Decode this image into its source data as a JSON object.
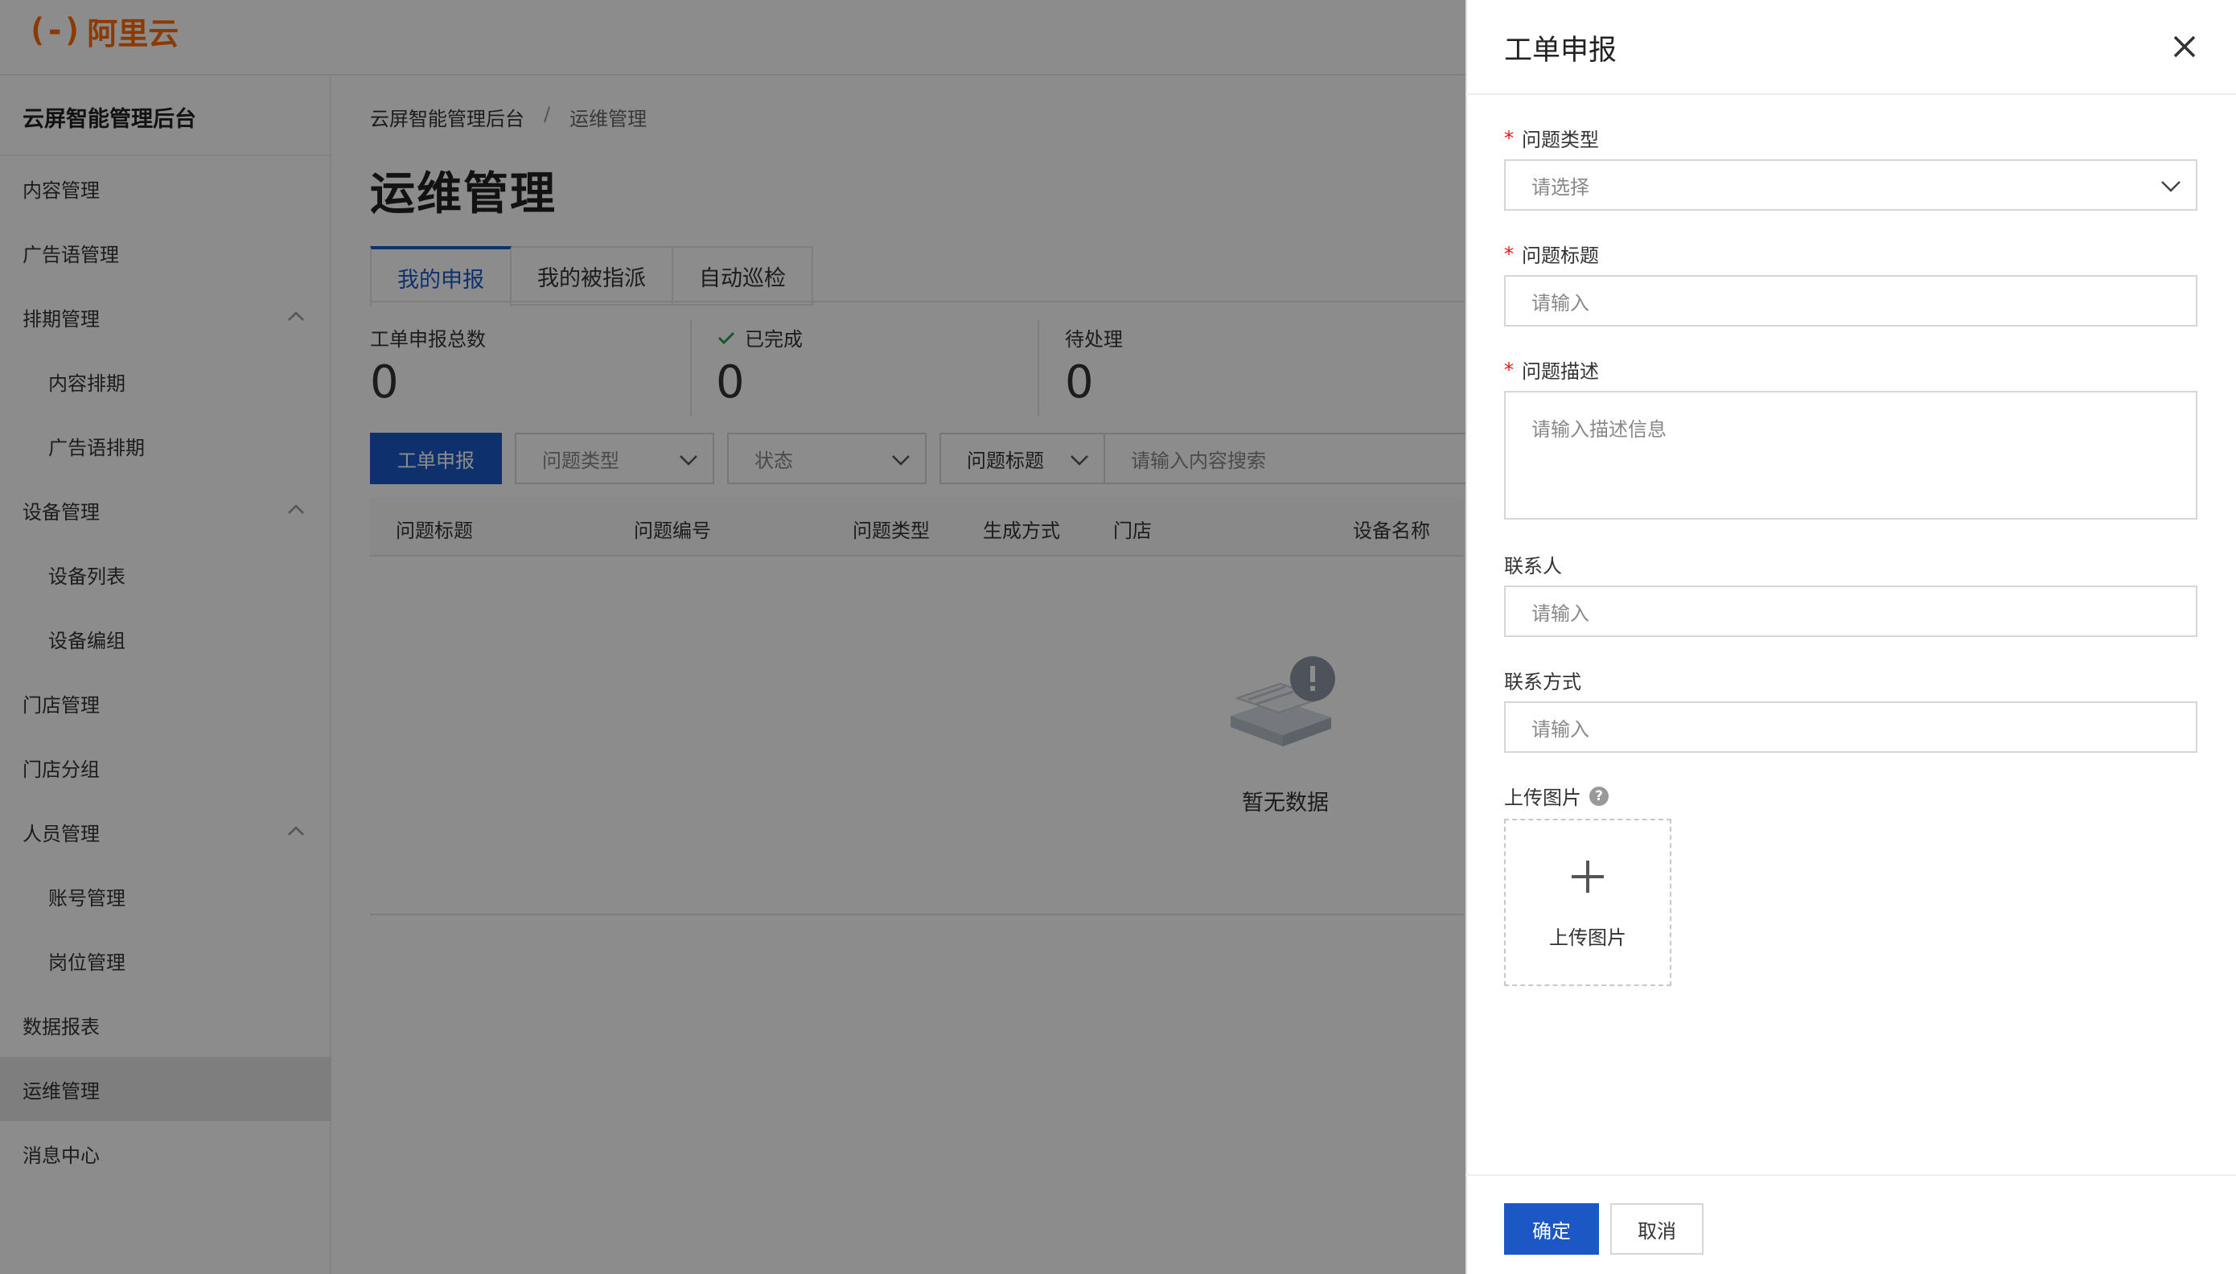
{
  "brand": {
    "logo_mark": "(-)",
    "logo_text": "阿里云"
  },
  "sidebar": {
    "title": "云屏智能管理后台",
    "items": [
      {
        "label": "内容管理"
      },
      {
        "label": "广告语管理"
      },
      {
        "label": "排期管理"
      },
      {
        "label": "内容排期"
      },
      {
        "label": "广告语排期"
      },
      {
        "label": "设备管理"
      },
      {
        "label": "设备列表"
      },
      {
        "label": "设备编组"
      },
      {
        "label": "门店管理"
      },
      {
        "label": "门店分组"
      },
      {
        "label": "人员管理"
      },
      {
        "label": "账号管理"
      },
      {
        "label": "岗位管理"
      },
      {
        "label": "数据报表"
      },
      {
        "label": "运维管理"
      },
      {
        "label": "消息中心"
      }
    ],
    "active": "运维管理"
  },
  "breadcrumb": {
    "root": "云屏智能管理后台",
    "sep": "/",
    "current": "运维管理"
  },
  "page": {
    "title": "运维管理"
  },
  "tabs": [
    {
      "label": "我的申报"
    },
    {
      "label": "我的被指派"
    },
    {
      "label": "自动巡检"
    }
  ],
  "stats": {
    "total_label": "工单申报总数",
    "total_value": "0",
    "done_label": "已完成",
    "done_value": "0",
    "pending_label": "待处理",
    "pending_value": "0"
  },
  "filters": {
    "report_button": "工单申报",
    "type_placeholder": "问题类型",
    "status_placeholder": "状态",
    "field_select": "问题标题",
    "search_placeholder": "请输入内容搜索"
  },
  "table": {
    "columns": [
      "问题标题",
      "问题编号",
      "问题类型",
      "生成方式",
      "门店",
      "设备名称"
    ],
    "empty_text": "暂无数据"
  },
  "drawer": {
    "title": "工单申报",
    "required_mark": "*",
    "fields": {
      "type_label": "问题类型",
      "type_placeholder": "请选择",
      "title_label": "问题标题",
      "title_placeholder": "请输入",
      "desc_label": "问题描述",
      "desc_placeholder": "请输入描述信息",
      "contact_label": "联系人",
      "contact_placeholder": "请输入",
      "phone_label": "联系方式",
      "phone_placeholder": "请输入",
      "upload_label": "上传图片",
      "upload_button": "上传图片",
      "help_glyph": "?"
    },
    "ok": "确定",
    "cancel": "取消"
  },
  "colors": {
    "primary": "#1b58c5",
    "brand": "#ff6a00",
    "required": "#e6141a"
  }
}
